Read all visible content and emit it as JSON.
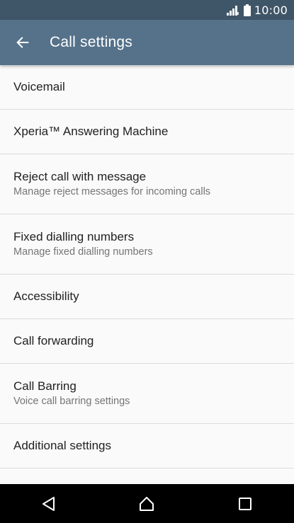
{
  "status_bar": {
    "time": "10:00",
    "signal_icon": "signal-icon",
    "battery_icon": "battery-icon"
  },
  "app_bar": {
    "title": "Call settings",
    "back_icon": "arrow-left-icon"
  },
  "settings": [
    {
      "title": "Voicemail",
      "subtitle": ""
    },
    {
      "title": "Xperia™ Answering Machine",
      "subtitle": ""
    },
    {
      "title": "Reject call with message",
      "subtitle": "Manage reject messages for incoming calls"
    },
    {
      "title": "Fixed dialling numbers",
      "subtitle": "Manage fixed dialling numbers"
    },
    {
      "title": "Accessibility",
      "subtitle": ""
    },
    {
      "title": "Call forwarding",
      "subtitle": ""
    },
    {
      "title": "Call Barring",
      "subtitle": "Voice call barring settings"
    },
    {
      "title": "Additional settings",
      "subtitle": ""
    }
  ],
  "nav_bar": {
    "back_icon": "nav-back-icon",
    "home_icon": "nav-home-icon",
    "recents_icon": "nav-recents-icon"
  },
  "colors": {
    "status_bar": "#3f5568",
    "app_bar": "#55728a",
    "background": "#fafafa",
    "nav_bar": "#000000"
  }
}
